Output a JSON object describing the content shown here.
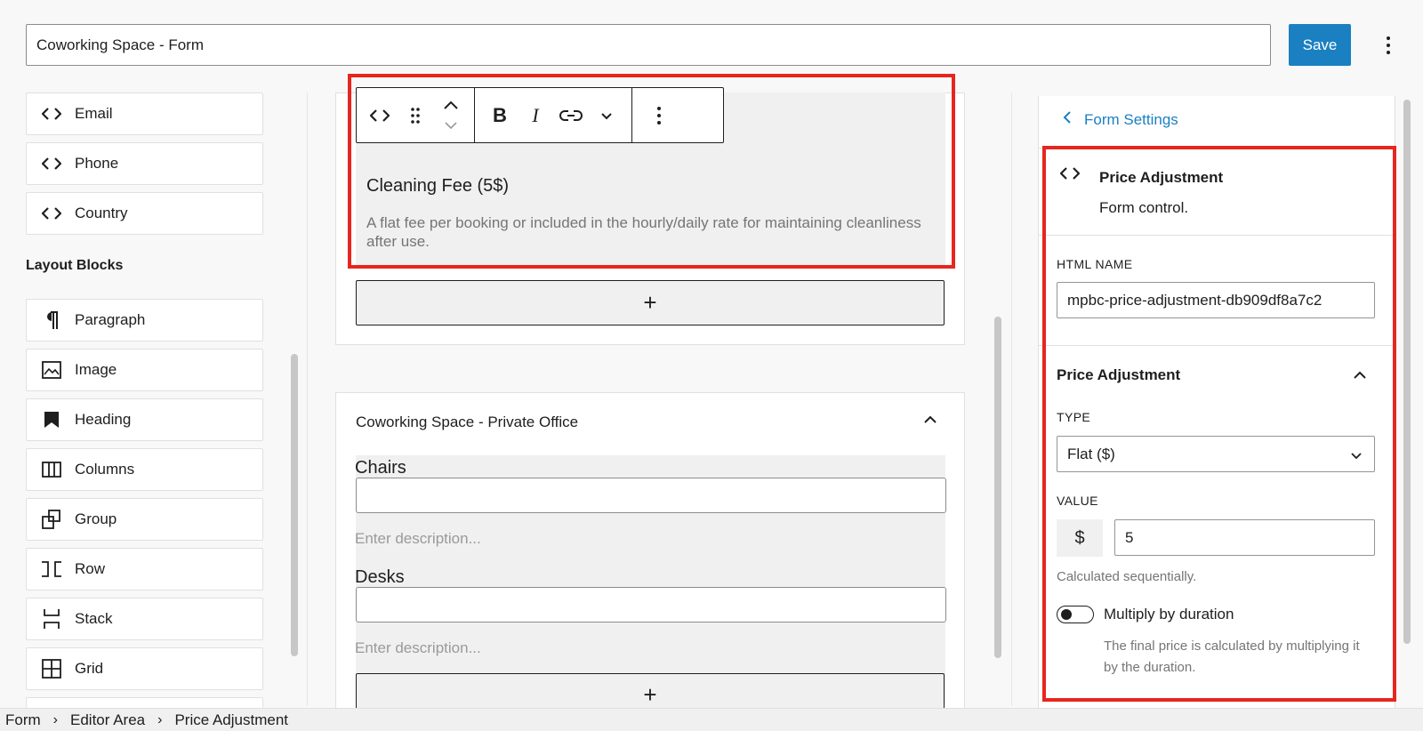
{
  "header": {
    "title_value": "Coworking Space - Form",
    "save_label": "Save"
  },
  "left_panel": {
    "field_blocks": [
      {
        "label": "Email",
        "icon": "code-icon"
      },
      {
        "label": "Phone",
        "icon": "code-icon"
      },
      {
        "label": "Country",
        "icon": "code-icon"
      }
    ],
    "layout_heading": "Layout Blocks",
    "layout_blocks": [
      {
        "label": "Paragraph",
        "icon": "paragraph-icon"
      },
      {
        "label": "Image",
        "icon": "image-icon"
      },
      {
        "label": "Heading",
        "icon": "heading-icon"
      },
      {
        "label": "Columns",
        "icon": "columns-icon"
      },
      {
        "label": "Group",
        "icon": "group-icon"
      },
      {
        "label": "Row",
        "icon": "row-icon"
      },
      {
        "label": "Stack",
        "icon": "stack-icon"
      },
      {
        "label": "Grid",
        "icon": "grid-icon"
      }
    ]
  },
  "editor": {
    "toolbar_bold": "B",
    "toolbar_italic": "I",
    "price_block": {
      "title": "Cleaning Fee (5$)",
      "description": "A flat fee per booking or included in the hourly/daily rate for maintaining cleanliness after use."
    },
    "add_symbol": "+",
    "section": {
      "title": "Coworking Space - Private Office",
      "fields": [
        {
          "label": "Chairs",
          "description_placeholder": "Enter description..."
        },
        {
          "label": "Desks",
          "description_placeholder": "Enter description..."
        }
      ]
    }
  },
  "sidebar": {
    "back_label": "Form Settings",
    "block_title": "Price Adjustment",
    "block_description": "Form control.",
    "html_name_label": "HTML NAME",
    "html_name_value": "mpbc-price-adjustment-db909df8a7c2",
    "panel_title": "Price Adjustment",
    "type_label": "TYPE",
    "type_value": "Flat ($)",
    "value_label": "VALUE",
    "value_prefix": "$",
    "value_value": "5",
    "help_text": "Calculated sequentially.",
    "toggle_label": "Multiply by duration",
    "toggle_on": false,
    "toggle_help": "The final price is calculated by multiplying it by the duration."
  },
  "breadcrumb": [
    "Form",
    "Editor Area",
    "Price Adjustment"
  ],
  "colors": {
    "accent": "#1a80c2",
    "highlight": "#e6261f"
  }
}
